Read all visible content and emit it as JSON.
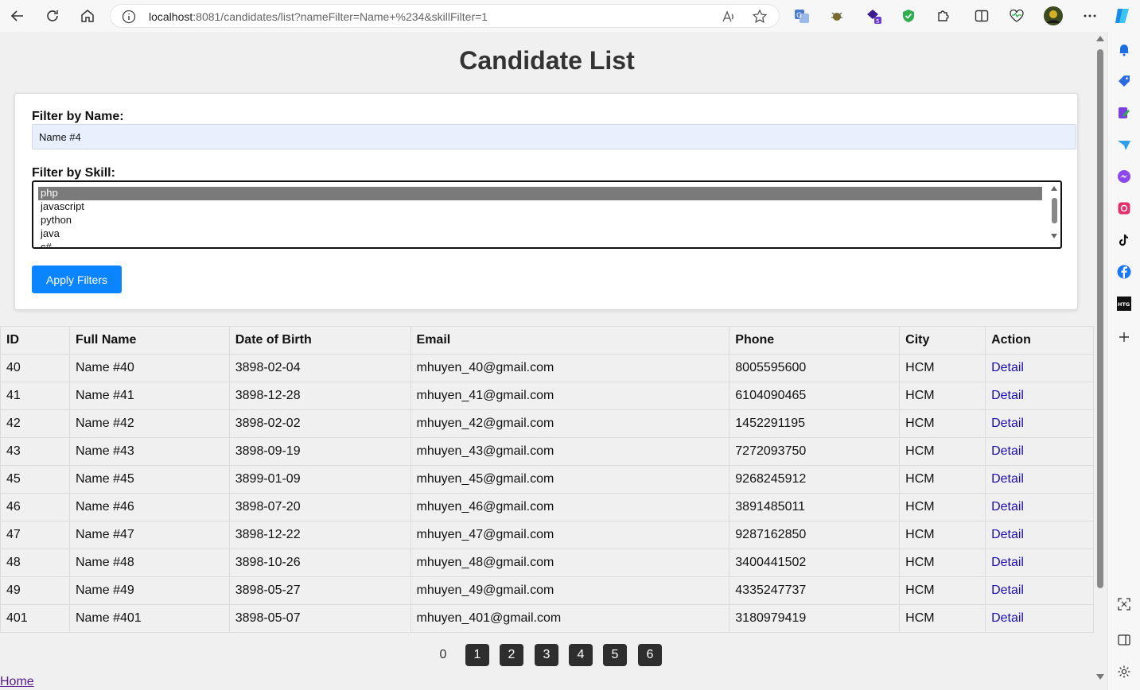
{
  "browser": {
    "url_host": "localhost",
    "url_rest": ":8081/candidates/list?nameFilter=Name+%234&skillFilter=1"
  },
  "page": {
    "title": "Candidate List",
    "filter_name_label": "Filter by Name:",
    "filter_name_value": "Name #4",
    "filter_skill_label": "Filter by Skill:",
    "skills": [
      "php",
      "javascript",
      "python",
      "java",
      "c#"
    ],
    "selected_skill": "php",
    "apply_label": "Apply Filters",
    "home_label": "Home"
  },
  "table": {
    "headers": [
      "ID",
      "Full Name",
      "Date of Birth",
      "Email",
      "Phone",
      "City",
      "Action"
    ],
    "rows": [
      [
        "40",
        "Name #40",
        "3898-02-04",
        "mhuyen_40@gmail.com",
        "8005595600",
        "HCM",
        "Detail"
      ],
      [
        "41",
        "Name #41",
        "3898-12-28",
        "mhuyen_41@gmail.com",
        "6104090465",
        "HCM",
        "Detail"
      ],
      [
        "42",
        "Name #42",
        "3898-02-02",
        "mhuyen_42@gmail.com",
        "1452291195",
        "HCM",
        "Detail"
      ],
      [
        "43",
        "Name #43",
        "3898-09-19",
        "mhuyen_43@gmail.com",
        "7272093750",
        "HCM",
        "Detail"
      ],
      [
        "45",
        "Name #45",
        "3899-01-09",
        "mhuyen_45@gmail.com",
        "9268245912",
        "HCM",
        "Detail"
      ],
      [
        "46",
        "Name #46",
        "3898-07-20",
        "mhuyen_46@gmail.com",
        "3891485011",
        "HCM",
        "Detail"
      ],
      [
        "47",
        "Name #47",
        "3898-12-22",
        "mhuyen_47@gmail.com",
        "9287162850",
        "HCM",
        "Detail"
      ],
      [
        "48",
        "Name #48",
        "3898-10-26",
        "mhuyen_48@gmail.com",
        "3400441502",
        "HCM",
        "Detail"
      ],
      [
        "49",
        "Name #49",
        "3898-05-27",
        "mhuyen_49@gmail.com",
        "4335247737",
        "HCM",
        "Detail"
      ],
      [
        "401",
        "Name #401",
        "3898-05-07",
        "mhuyen_401@gmail.com",
        "3180979419",
        "HCM",
        "Detail"
      ]
    ]
  },
  "pagination": {
    "current": "0",
    "pages": [
      "1",
      "2",
      "3",
      "4",
      "5",
      "6"
    ]
  }
}
